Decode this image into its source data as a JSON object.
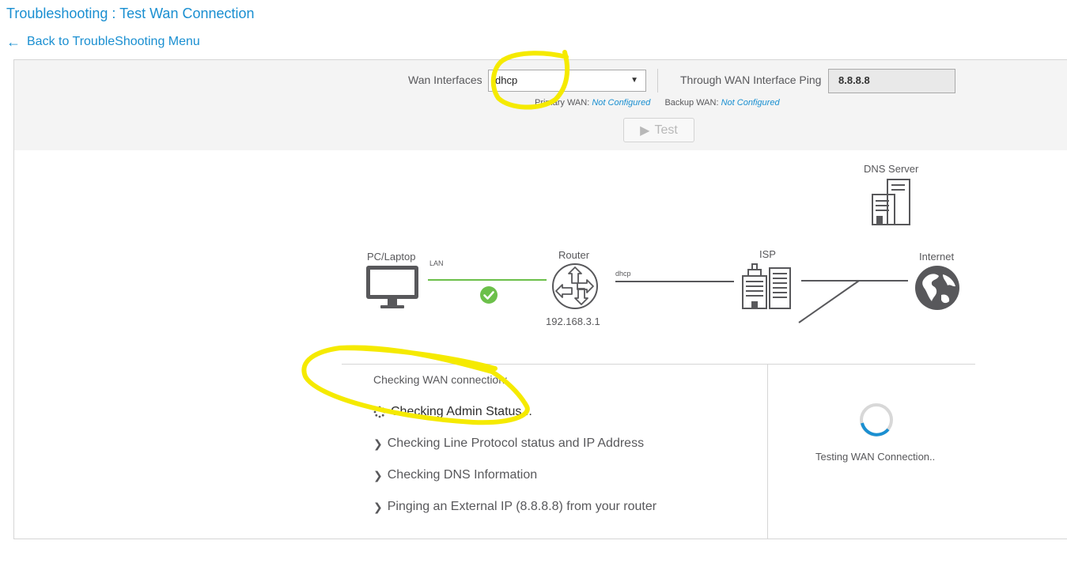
{
  "page": {
    "title": "Troubleshooting : Test Wan Connection",
    "back_label": "Back to TroubleShooting Menu"
  },
  "toolbar": {
    "wan_label": "Wan Interfaces",
    "wan_selected": "dhcp",
    "ping_label": "Through WAN Interface Ping",
    "ping_value": "8.8.8.8",
    "primary_label": "Primary WAN:",
    "primary_value": "Not Configured",
    "backup_label": "Backup WAN:",
    "backup_value": "Not Configured",
    "test_label": "Test"
  },
  "diagram": {
    "pc_label": "PC/Laptop",
    "lan_label": "LAN",
    "router_label": "Router",
    "router_ip": "192.168.3.1",
    "wan_link_label": "dhcp",
    "isp_label": "ISP",
    "dns_label": "DNS Server",
    "internet_label": "Internet"
  },
  "results": {
    "title": "Checking WAN connection:",
    "steps": [
      {
        "label": "Checking Admin Status ..",
        "state": "in-progress"
      },
      {
        "label": "Checking Line Protocol status and IP Address",
        "state": "pending"
      },
      {
        "label": "Checking DNS Information",
        "state": "pending"
      },
      {
        "label": "Pinging an External IP (8.8.8.8) from your router",
        "state": "pending"
      }
    ],
    "status_text": "Testing WAN Connection.."
  },
  "colors": {
    "accent": "#1a8fd1",
    "success": "#6cc04a",
    "icon": "#58585b",
    "annotation": "#f5ea00"
  }
}
